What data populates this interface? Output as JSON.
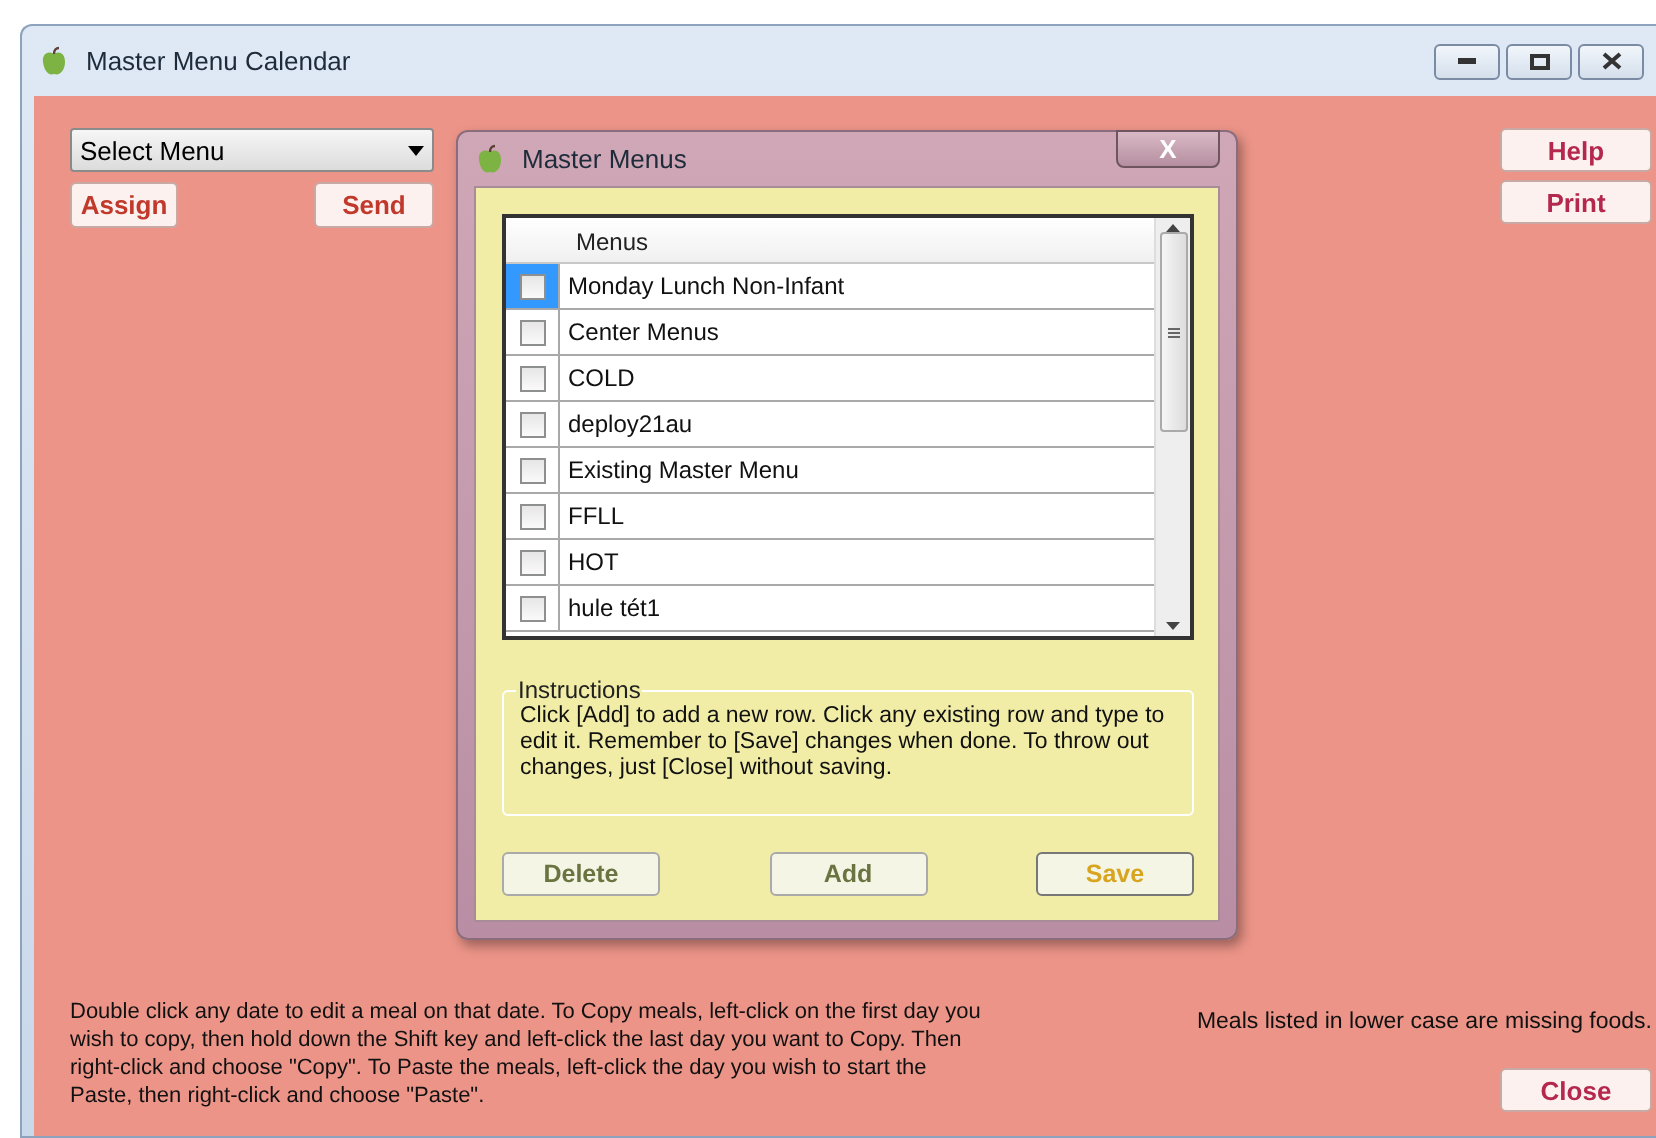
{
  "window": {
    "title": "Master Menu Calendar"
  },
  "menu_select": {
    "value": "Select Menu"
  },
  "left_buttons": [
    "Assign",
    "Send"
  ],
  "right_buttons": [
    "Help",
    "Print"
  ],
  "dialog": {
    "title": "Master Menus",
    "close": "X",
    "grid": {
      "columns": [
        "Menus"
      ],
      "rows": [
        {
          "name": "Monday Lunch Non-Infant",
          "checked": false,
          "selected": true
        },
        {
          "name": "Center Menus",
          "checked": false,
          "selected": false
        },
        {
          "name": "COLD",
          "checked": false,
          "selected": false
        },
        {
          "name": "deploy21au",
          "checked": false,
          "selected": false
        },
        {
          "name": "Existing Master Menu",
          "checked": false,
          "selected": false
        },
        {
          "name": "FFLL",
          "checked": false,
          "selected": false
        },
        {
          "name": "HOT",
          "checked": false,
          "selected": false
        },
        {
          "name": "hule tét1",
          "checked": false,
          "selected": false
        }
      ]
    },
    "instructions": {
      "title": "Instructions",
      "text": "Click [Add] to add a new row.  Click any existing row and type to edit it.  Remember to [Save] changes when done.  To throw out changes, just [Close] without saving."
    },
    "buttons": [
      {
        "label": "Delete",
        "default": false
      },
      {
        "label": "Add",
        "default": false
      },
      {
        "label": "Save",
        "default": true
      }
    ]
  },
  "help_text": "Double click any date to edit a meal on that date.  To Copy meals, left-click on the first day you wish to copy, then hold down the Shift key and left-click the last day you want to Copy.  Then right-click and choose \"Copy\".  To Paste the meals, left-click the day you wish to start the Paste, then right-click and choose \"Paste\".",
  "note": "Meals listed in lower case are missing foods.",
  "close_button": "Close"
}
